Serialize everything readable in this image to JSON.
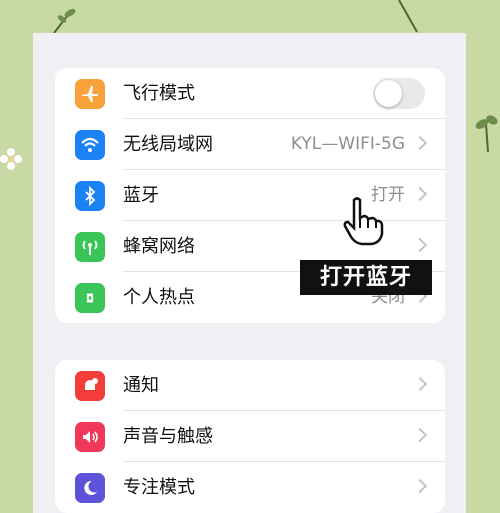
{
  "settings_group_1": {
    "items": [
      {
        "label": "飞行模式",
        "icon": "airplane-icon",
        "color": "#f7a23a",
        "control": "toggle",
        "toggle_on": false
      },
      {
        "label": "无线局域网",
        "icon": "wifi-icon",
        "color": "#1b82f3",
        "value": "KYL—WIFI-5G"
      },
      {
        "label": "蓝牙",
        "icon": "bluetooth-icon",
        "color": "#1b82f3",
        "value": "打开"
      },
      {
        "label": "蜂窝网络",
        "icon": "cellular-icon",
        "color": "#3bc458",
        "value": ""
      },
      {
        "label": "个人热点",
        "icon": "hotspot-icon",
        "color": "#3bc458",
        "value": "关闭"
      }
    ]
  },
  "settings_group_2": {
    "items": [
      {
        "label": "通知",
        "icon": "notification-icon",
        "color": "#f23d3a"
      },
      {
        "label": "声音与触感",
        "icon": "sound-icon",
        "color": "#f2385a"
      },
      {
        "label": "专注模式",
        "icon": "moon-icon",
        "color": "#5d52d8"
      }
    ]
  },
  "callout": {
    "text": "打开蓝牙"
  },
  "cursor": {
    "icon": "hand-pointer-icon"
  }
}
